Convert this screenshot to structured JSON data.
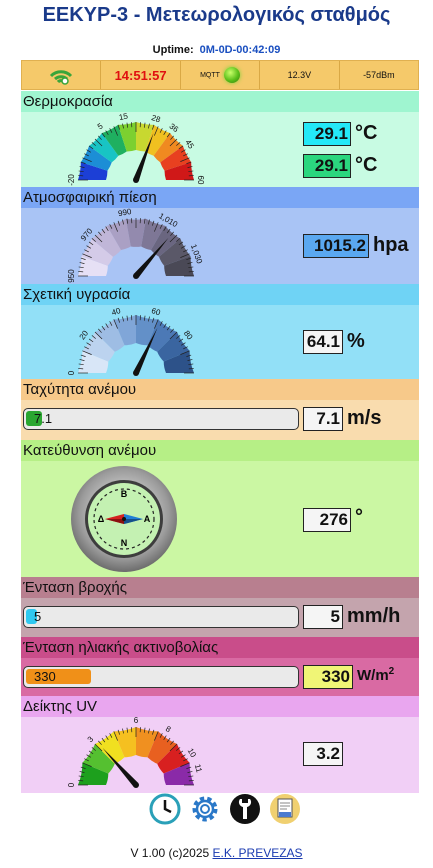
{
  "header": {
    "title": "EEKYP-3 - Μετεωρολογικός σταθμός",
    "uptime_label": "Uptime:",
    "uptime_value": "0M-0D-00:42:09"
  },
  "status": {
    "time": "14:51:57",
    "mqtt": "MQTT",
    "voltage": "12.3V",
    "signal": "-57dBm"
  },
  "temperature": {
    "title": "Θερμοκρασία",
    "value1": "29.1",
    "value2": "29.1",
    "unit": "°C",
    "ticks": [
      "-20",
      "5",
      "15",
      "28",
      "36",
      "45",
      "60"
    ],
    "needle": 29.1,
    "min": -20,
    "max": 60
  },
  "pressure": {
    "title": "Ατμοσφαιρική πίεση",
    "value": "1015.2",
    "unit": "hpa",
    "ticks": [
      "950",
      "970",
      "990",
      "1,010",
      "1,030"
    ],
    "needle": 1015.2,
    "min": 950,
    "max": 1040
  },
  "humidity": {
    "title": "Σχετική υγρασία",
    "value": "64.1",
    "unit": "%",
    "ticks": [
      "0",
      "20",
      "40",
      "60",
      "80"
    ],
    "needle": 64.1,
    "min": 0,
    "max": 100
  },
  "wind_speed": {
    "title": "Ταχύτητα ανέμου",
    "value": "7.1",
    "bar_label": "7.1",
    "unit": "m/s",
    "fraction": 0.06
  },
  "wind_dir": {
    "title": "Κατεύθυνση ανέμου",
    "value": "276",
    "unit": "°",
    "n": "B",
    "s": "N",
    "e": "A",
    "w": "Δ"
  },
  "rain": {
    "title": "Ένταση βροχής",
    "value": "5",
    "bar_label": "5",
    "unit": "mm/h",
    "fraction": 0.04
  },
  "solar": {
    "title": "Ένταση ηλιακής ακτινοβολίας",
    "value": "330",
    "bar_label": "330",
    "unit": "W/m",
    "unit_sup": "2",
    "fraction": 0.24
  },
  "uv": {
    "title": "Δείκτης UV",
    "value": "3.2",
    "ticks": [
      "0",
      "3",
      "6",
      "8",
      "10",
      "11"
    ],
    "needle": 3.2,
    "min": 0,
    "max": 12
  },
  "footer": {
    "text": "V 1.00 (c)2025",
    "link": "E.K. PREVEZAS"
  }
}
